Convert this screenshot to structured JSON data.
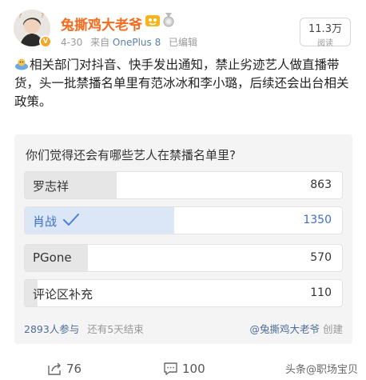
{
  "post": {
    "username": "兔撕鸡大老爷",
    "date": "4-30",
    "from_prefix": "来自",
    "device": "OnePlus 8",
    "edited": "已编辑",
    "reads_count": "11.3万",
    "reads_label": "阅读",
    "text": "相关部门对抖音、快手发出通知，禁止劣迹艺人做直播带货，头一批禁播名单里有范冰冰和李小璐，后续还会出台相关政策。"
  },
  "poll": {
    "question": "你们觉得还会有哪些艺人在禁播名单里?",
    "options": [
      {
        "name": "罗志祥",
        "count": "863",
        "share": 0.29
      },
      {
        "name": "肖战",
        "count": "1350",
        "share": 0.47,
        "voted": true
      },
      {
        "name": "PGone",
        "count": "570",
        "share": 0.2
      },
      {
        "name": "评论区补充",
        "count": "110",
        "share": 0.04
      }
    ],
    "participants": "2893人参与",
    "remaining": "还有5天结束",
    "creator": "@兔撕鸡大老爷",
    "created_label": "创建"
  },
  "actions": {
    "share_count": "76",
    "comment_count": "100"
  },
  "watermark": "头条@职场宝贝",
  "colors": {
    "username": "#f56a1d",
    "link": "#4d6d9a",
    "voted_fill": "#dbe7f6",
    "bar_fill": "#e6e6e6"
  },
  "icons": [
    "avatar",
    "verified-badge-icon",
    "vip-badge-icon",
    "medal-icon",
    "bubble-emoji-icon",
    "checkmark-icon",
    "share-icon",
    "comment-icon"
  ]
}
